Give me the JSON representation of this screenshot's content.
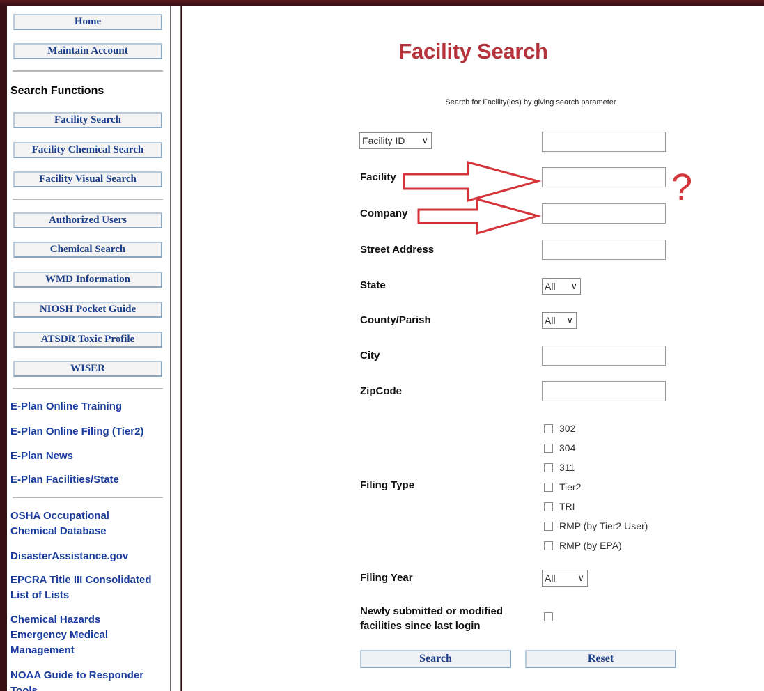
{
  "sidebar": {
    "top_buttons": [
      "Home",
      "Maintain Account"
    ],
    "search_heading": "Search Functions",
    "search_buttons": [
      "Facility Search",
      "Facility Chemical Search",
      "Facility Visual Search"
    ],
    "ref_buttons": [
      "Authorized Users",
      "Chemical Search",
      "WMD Information",
      "NIOSH Pocket Guide",
      "ATSDR Toxic Profile",
      "WISER"
    ],
    "eplan_links": [
      "E-Plan Online Training",
      "E-Plan Online Filing (Tier2)",
      "E-Plan News",
      "E-Plan Facilities/State"
    ],
    "other_links": [
      "OSHA Occupational Chemical Database",
      "DisasterAssistance.gov",
      "EPCRA Title III Consolidated List of Lists",
      "Chemical Hazards Emergency Medical Management",
      "NOAA Guide to Responder Tools"
    ]
  },
  "main": {
    "title": "Facility Search",
    "subtitle": "Search for Facility(ies) by giving search parameter",
    "id_select": "Facility ID",
    "labels": {
      "facility": "Facility",
      "company": "Company",
      "street": "Street Address",
      "state": "State",
      "county": "County/Parish",
      "city": "City",
      "zip": "ZipCode",
      "filing_type": "Filing Type",
      "filing_year": "Filing Year",
      "newly": "Newly submitted or modified facilities since last login"
    },
    "state_value": "All",
    "county_value": "All",
    "filing_year_value": "All",
    "filing_types": [
      "302",
      "304",
      "311",
      "Tier2",
      "TRI",
      "RMP (by Tier2 User)",
      "RMP (by EPA)"
    ],
    "search_label": "Search",
    "reset_label": "Reset"
  },
  "annotation": {
    "question_mark": "?",
    "color": "#d4343a"
  }
}
